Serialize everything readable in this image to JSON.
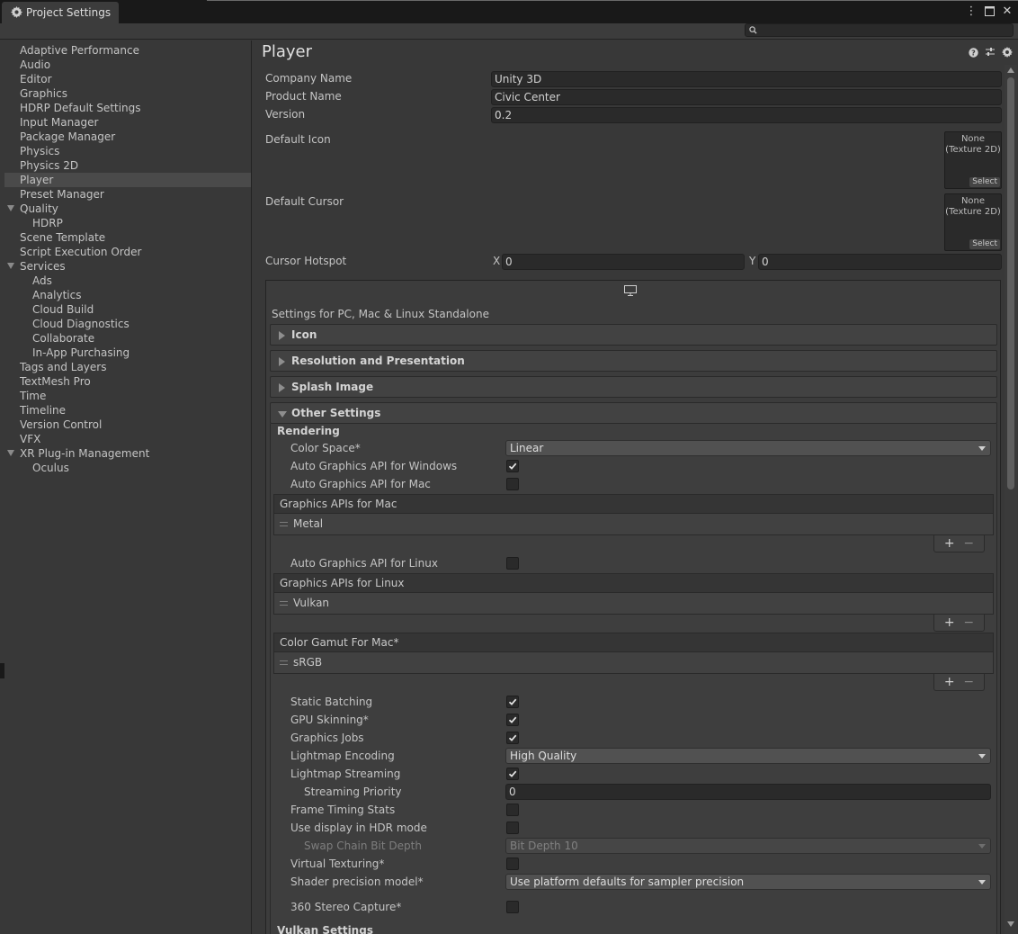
{
  "window": {
    "tab_title": "Project Settings",
    "search_placeholder": ""
  },
  "sidebar": {
    "items": [
      {
        "label": "Adaptive Performance"
      },
      {
        "label": "Audio"
      },
      {
        "label": "Editor"
      },
      {
        "label": "Graphics"
      },
      {
        "label": "HDRP Default Settings"
      },
      {
        "label": "Input Manager"
      },
      {
        "label": "Package Manager"
      },
      {
        "label": "Physics"
      },
      {
        "label": "Physics 2D"
      },
      {
        "label": "Player"
      },
      {
        "label": "Preset Manager"
      },
      {
        "label": "Quality"
      },
      {
        "label": "HDRP"
      },
      {
        "label": "Scene Template"
      },
      {
        "label": "Script Execution Order"
      },
      {
        "label": "Services"
      },
      {
        "label": "Ads"
      },
      {
        "label": "Analytics"
      },
      {
        "label": "Cloud Build"
      },
      {
        "label": "Cloud Diagnostics"
      },
      {
        "label": "Collaborate"
      },
      {
        "label": "In-App Purchasing"
      },
      {
        "label": "Tags and Layers"
      },
      {
        "label": "TextMesh Pro"
      },
      {
        "label": "Time"
      },
      {
        "label": "Timeline"
      },
      {
        "label": "Version Control"
      },
      {
        "label": "VFX"
      },
      {
        "label": "XR Plug-in Management"
      },
      {
        "label": "Oculus"
      }
    ],
    "selected": "Player"
  },
  "player": {
    "title": "Player",
    "company_name_label": "Company Name",
    "company_name": "Unity 3D",
    "product_name_label": "Product Name",
    "product_name": "Civic Center",
    "version_label": "Version",
    "version": "0.2",
    "default_icon_label": "Default Icon",
    "default_cursor_label": "Default Cursor",
    "object_none": "None",
    "object_type": "(Texture 2D)",
    "select_label": "Select",
    "cursor_hotspot_label": "Cursor Hotspot",
    "hotspot_x_label": "X",
    "hotspot_x": "0",
    "hotspot_y_label": "Y",
    "hotspot_y": "0"
  },
  "platform": {
    "settings_label": "Settings for PC, Mac & Linux Standalone",
    "sections": {
      "icon": "Icon",
      "resolution": "Resolution and Presentation",
      "splash": "Splash Image",
      "other": "Other Settings"
    }
  },
  "other_settings": {
    "rendering_label": "Rendering",
    "color_space_label": "Color Space*",
    "color_space": "Linear",
    "auto_api_windows_label": "Auto Graphics API  for Windows",
    "auto_api_windows": true,
    "auto_api_mac_label": "Auto Graphics API  for Mac",
    "auto_api_mac": false,
    "mac_apis_header": "Graphics APIs for Mac",
    "mac_apis": [
      "Metal"
    ],
    "auto_api_linux_label": "Auto Graphics API  for Linux",
    "auto_api_linux": false,
    "linux_apis_header": "Graphics APIs for Linux",
    "linux_apis": [
      "Vulkan"
    ],
    "gamut_header": "Color Gamut For Mac*",
    "gamut": [
      "sRGB"
    ],
    "static_batching_label": "Static Batching",
    "static_batching": true,
    "gpu_skinning_label": "GPU Skinning*",
    "gpu_skinning": true,
    "graphics_jobs_label": "Graphics Jobs",
    "graphics_jobs": true,
    "lightmap_encoding_label": "Lightmap Encoding",
    "lightmap_encoding": "High Quality",
    "lightmap_streaming_label": "Lightmap Streaming",
    "lightmap_streaming": true,
    "streaming_priority_label": "Streaming Priority",
    "streaming_priority": "0",
    "frame_timing_label": "Frame Timing Stats",
    "frame_timing": false,
    "hdr_display_label": "Use display in HDR mode",
    "hdr_display": false,
    "swap_chain_label": "Swap Chain Bit Depth",
    "swap_chain": "Bit Depth 10",
    "virtual_texturing_label": "Virtual Texturing*",
    "virtual_texturing": false,
    "shader_precision_label": "Shader precision model*",
    "shader_precision": "Use platform defaults for sampler precision",
    "stereo_capture_label": "360 Stereo Capture*",
    "stereo_capture": false,
    "vulkan_settings_label": "Vulkan Settings"
  },
  "list_controls": {
    "add": "+",
    "remove": "−"
  },
  "colors": {
    "background": "#383838",
    "field": "#2a2a2a",
    "selected_row": "#4a4a4a"
  }
}
